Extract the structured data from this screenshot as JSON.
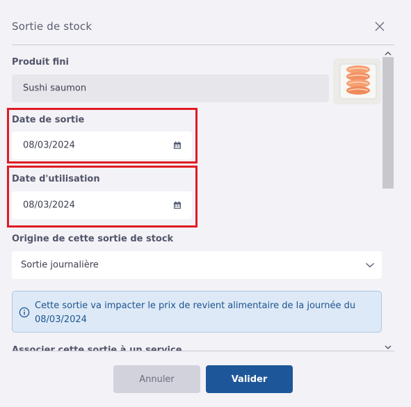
{
  "modal": {
    "title": "Sortie de stock",
    "close_icon": "close-icon"
  },
  "form": {
    "product": {
      "label": "Produit fini",
      "value": "Sushi saumon",
      "thumbnail_icon": "sushi-image"
    },
    "exit_date": {
      "label": "Date de sortie",
      "value": "08/03/2024",
      "icon": "calendar-icon"
    },
    "use_date": {
      "label": "Date d'utilisation",
      "value": "08/03/2024",
      "icon": "calendar-icon"
    },
    "origin": {
      "label": "Origine de cette sortie de stock",
      "value": "Sortie journalière",
      "icon": "chevron-down-icon"
    },
    "info": {
      "icon": "info-icon",
      "text_line1": "Cette sortie va impacter le prix de revient alimentaire de la journée du",
      "text_line2": "08/03/2024"
    },
    "service": {
      "label": "Associer cette sortie à un service"
    }
  },
  "footer": {
    "cancel_label": "Annuler",
    "validate_label": "Valider"
  },
  "colors": {
    "background": "#f3f2f6",
    "primary": "#1d5799",
    "highlight": "#e01b24",
    "info_bg": "#dde9f6",
    "info_text": "#1c5490"
  }
}
